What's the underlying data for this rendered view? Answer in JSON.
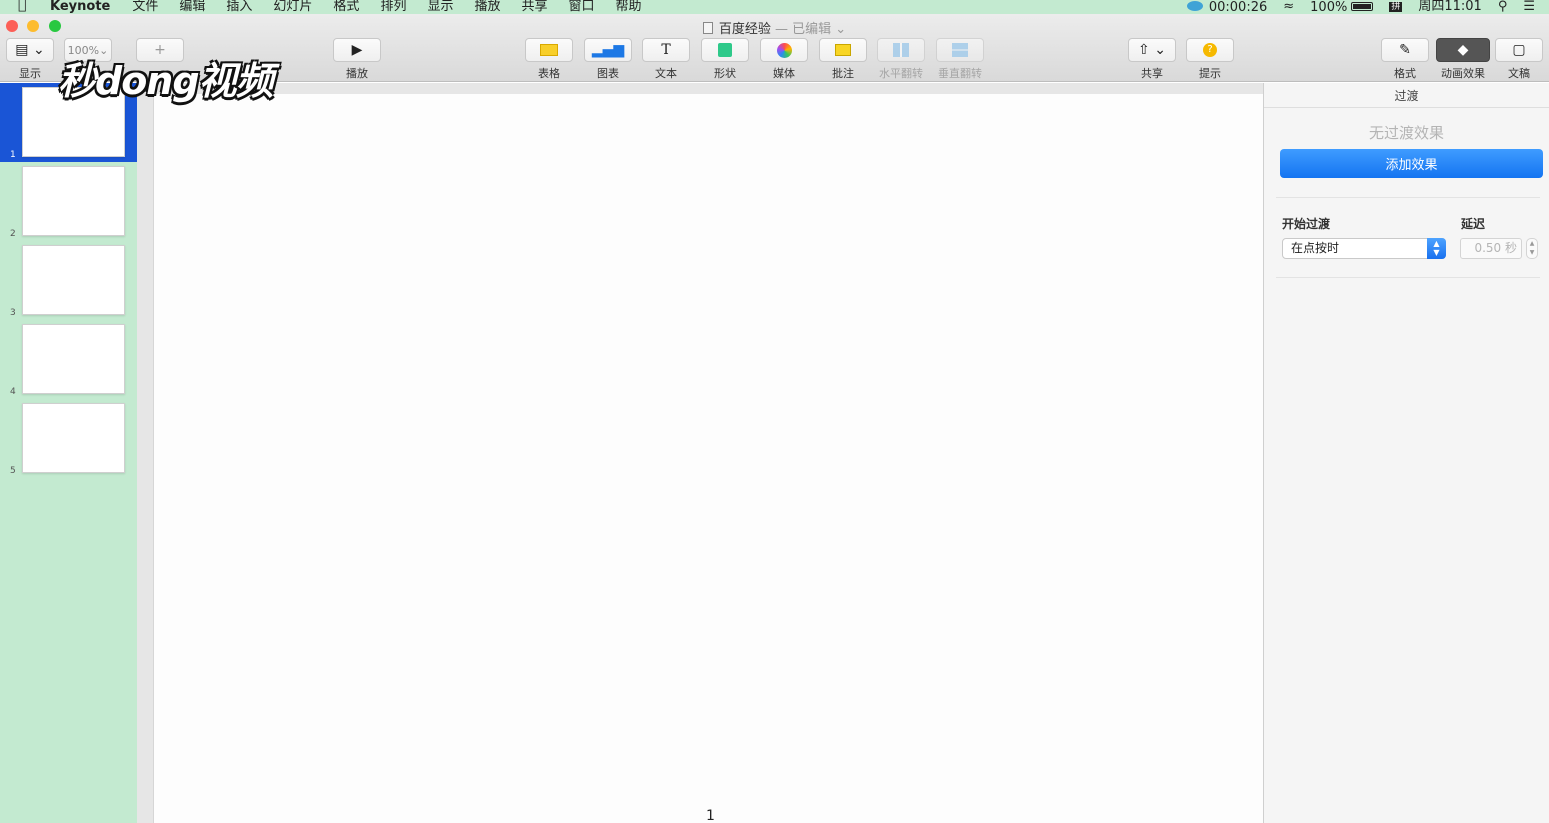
{
  "menubar": {
    "app_name": "Keynote",
    "items": [
      "文件",
      "编辑",
      "插入",
      "幻灯片",
      "格式",
      "排列",
      "显示",
      "播放",
      "共享",
      "窗口",
      "帮助"
    ],
    "timer": "00:00:26",
    "battery": "100%",
    "ime": "拼",
    "clock": "周四11:01"
  },
  "window": {
    "title": "百度经验",
    "title_status": "— 已编辑"
  },
  "toolbar": {
    "view_label": "显示",
    "zoom_value": "100%",
    "play_label": "播放",
    "table_label": "表格",
    "chart_label": "图表",
    "text_label": "文本",
    "shape_label": "形状",
    "media_label": "媒体",
    "comment_label": "批注",
    "flip_h_label": "水平翻转",
    "flip_v_label": "垂直翻转",
    "share_label": "共享",
    "tips_label": "提示",
    "format_label": "格式",
    "animate_label": "动画效果",
    "document_label": "文稿"
  },
  "watermark": "秒dong视频",
  "slides": [
    {
      "number": "1",
      "selected": true
    },
    {
      "number": "2",
      "selected": false
    },
    {
      "number": "3",
      "selected": false
    },
    {
      "number": "4",
      "selected": false
    },
    {
      "number": "5",
      "selected": false
    }
  ],
  "canvas": {
    "slide_number": "1"
  },
  "inspector": {
    "tab": "过渡",
    "no_transition": "无过渡效果",
    "add_effect": "添加效果",
    "start_transition_label": "开始过渡",
    "start_transition_value": "在点按时",
    "delay_label": "延迟",
    "delay_value": "0.50 秒"
  },
  "colors": {
    "accent_blue": "#1474f1",
    "navigator_bg": "#c3ead0",
    "selection": "#1a55d6"
  }
}
